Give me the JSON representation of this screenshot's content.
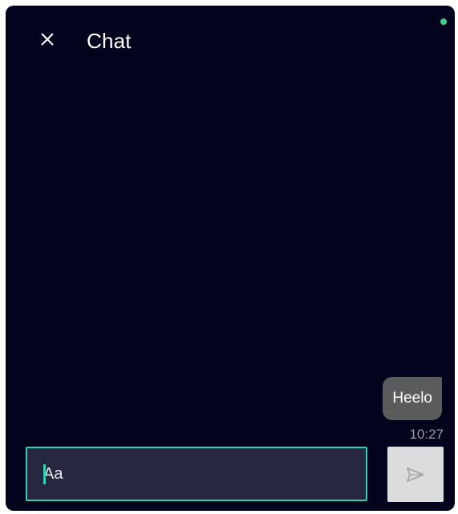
{
  "header": {
    "title": "Chat",
    "close_icon": "close-icon"
  },
  "status": {
    "indicator_color": "#3ad18a",
    "online": true
  },
  "messages": [
    {
      "text": "Heelo",
      "time": "10:27",
      "direction": "outgoing"
    }
  ],
  "composer": {
    "placeholder": "Aa",
    "value": "",
    "send_icon": "send-icon"
  },
  "colors": {
    "background": "#03031e",
    "accent": "#2fd1b4",
    "bubble": "#5b5b5b",
    "send_button": "#dcdcdc"
  }
}
